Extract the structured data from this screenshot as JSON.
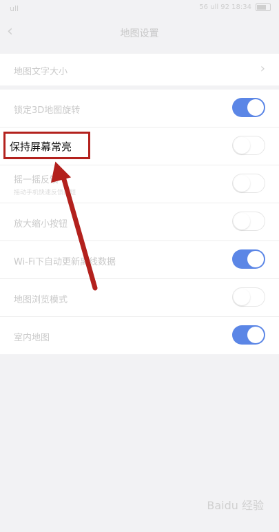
{
  "status_bar": {
    "carrier": "ull",
    "right_text": "56 ull 92 18:34"
  },
  "nav": {
    "title": "地图设置"
  },
  "settings": {
    "map_text_size": "地图文字大小",
    "lock_3d_rotation": "锁定3D地图旋转",
    "keep_screen_on": "保持屏幕常亮",
    "shake_label": "摇一摇反馈",
    "shake_desc": "摇动手机快速反馈问题",
    "zoom_buttons": "放大缩小按钮",
    "wifi_offline": "Wi-Fi下自动更新离线数据",
    "map_browse": "地图浏览模式",
    "indoor_map": "室内地图"
  },
  "toggles": {
    "lock_3d_rotation": true,
    "keep_screen_on": false,
    "shake": false,
    "zoom_buttons": false,
    "wifi_offline": true,
    "map_browse": false,
    "indoor_map": true
  },
  "colors": {
    "toggle_on": "#5b86e6",
    "annotation": "#b3211d"
  },
  "watermark": "Baidu 经验"
}
